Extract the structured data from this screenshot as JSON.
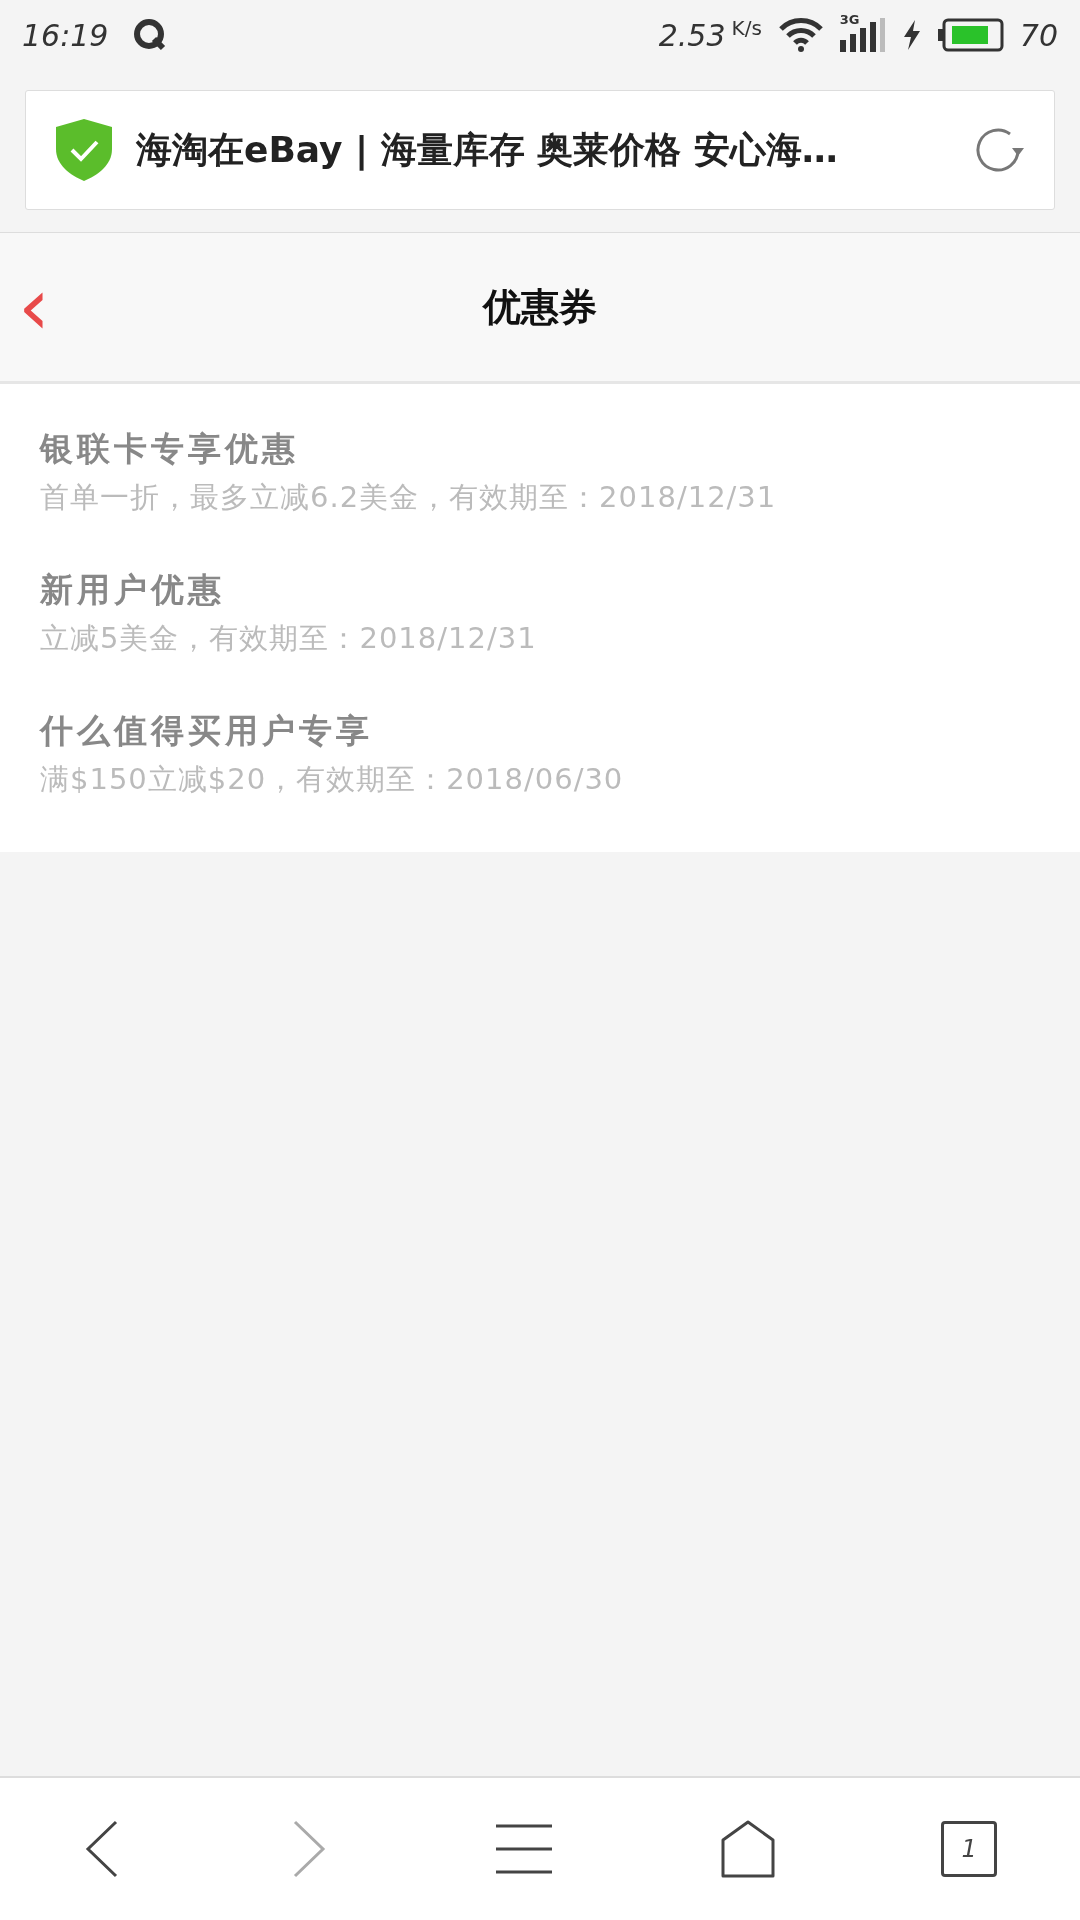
{
  "status_bar": {
    "time": "16:19",
    "speed": "2.53",
    "speed_unit": "K/s",
    "network": "3G",
    "battery": "70"
  },
  "address_bar": {
    "title": "海淘在eBay | 海量库存 奥莱价格 安心海…"
  },
  "header": {
    "back": "‹",
    "title": "优惠券"
  },
  "coupons": [
    {
      "title": "银联卡专享优惠",
      "detail": "首单一折，最多立减6.2美金，有效期至：2018/12/31"
    },
    {
      "title": "新用户优惠",
      "detail": "立减5美金，有效期至：2018/12/31"
    },
    {
      "title": "什么值得买用户专享",
      "detail": "满$150立减$20，有效期至：2018/06/30"
    }
  ],
  "bottom_nav": {
    "back_disabled": false,
    "forward_disabled": true,
    "tab_count": "1"
  }
}
